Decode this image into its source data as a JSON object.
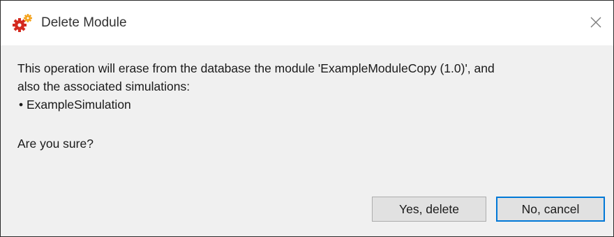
{
  "window": {
    "title": "Delete Module",
    "icon": "red-orange-gears-icon",
    "close_icon": "close-icon"
  },
  "message": {
    "line1": "This operation will erase from the database the module 'ExampleModuleCopy (1.0)', and",
    "line2": "also the associated simulations:",
    "bullet": "• ExampleSimulation",
    "confirm": "Are you sure?"
  },
  "buttons": {
    "yes_label": "Yes, delete",
    "no_label": "No, cancel"
  },
  "colors": {
    "gear_primary": "#d42a1f",
    "gear_secondary": "#f4a21a",
    "focus_border": "#0078d7"
  }
}
